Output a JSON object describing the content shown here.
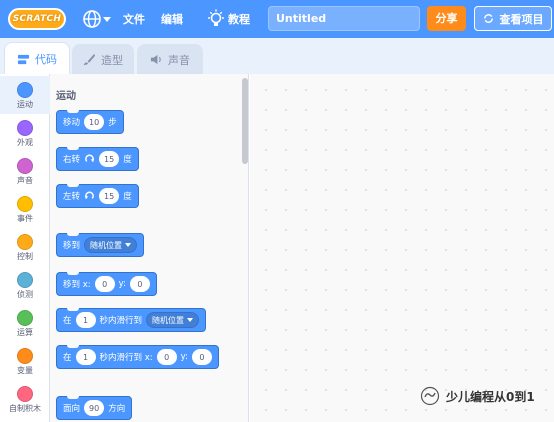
{
  "menubar": {
    "logo_text": "SCRATCH",
    "file": "文件",
    "edit": "编辑",
    "tutorials": "教程",
    "project_title": "Untitled",
    "share": "分享",
    "see_project": "查看项目"
  },
  "tabs": [
    {
      "label": "代码",
      "icon": "code-icon",
      "active": true
    },
    {
      "label": "造型",
      "icon": "brush-icon",
      "active": false
    },
    {
      "label": "声音",
      "icon": "speaker-icon",
      "active": false
    }
  ],
  "categories": [
    {
      "label": "运动",
      "color": "#4c97ff"
    },
    {
      "label": "外观",
      "color": "#9966ff"
    },
    {
      "label": "声音",
      "color": "#cf63cf"
    },
    {
      "label": "事件",
      "color": "#ffbf00"
    },
    {
      "label": "控制",
      "color": "#ffab19"
    },
    {
      "label": "侦测",
      "color": "#5cb1d6"
    },
    {
      "label": "运算",
      "color": "#59c059"
    },
    {
      "label": "变量",
      "color": "#ff8c1a"
    },
    {
      "label": "自制积木",
      "color": "#ff6680"
    }
  ],
  "palette": {
    "section_title": "运动",
    "blocks": {
      "move": {
        "pre": "移动",
        "value": "10",
        "post": "步"
      },
      "turn_right": {
        "pre": "右转",
        "value": "15",
        "post": "度"
      },
      "turn_left": {
        "pre": "左转",
        "value": "15",
        "post": "度"
      },
      "goto": {
        "pre": "移到",
        "dropdown": "随机位置"
      },
      "goto_xy": {
        "pre": "移到 x:",
        "x": "0",
        "mid": "y:",
        "y": "0"
      },
      "glide": {
        "pre": "在",
        "secs": "1",
        "mid": "秒内滑行到",
        "dropdown": "随机位置"
      },
      "glide_xy": {
        "pre": "在",
        "secs": "1",
        "mid": "秒内滑行到 x:",
        "x": "0",
        "ylbl": "y:",
        "y": "0"
      },
      "point": {
        "pre": "面向",
        "value": "90",
        "post": "方向"
      }
    }
  },
  "watermark": {
    "text": "少儿编程从0到1"
  },
  "colors": {
    "accent": "#4c97ff",
    "share": "#ff8c1a",
    "logo": "#ffab19"
  }
}
